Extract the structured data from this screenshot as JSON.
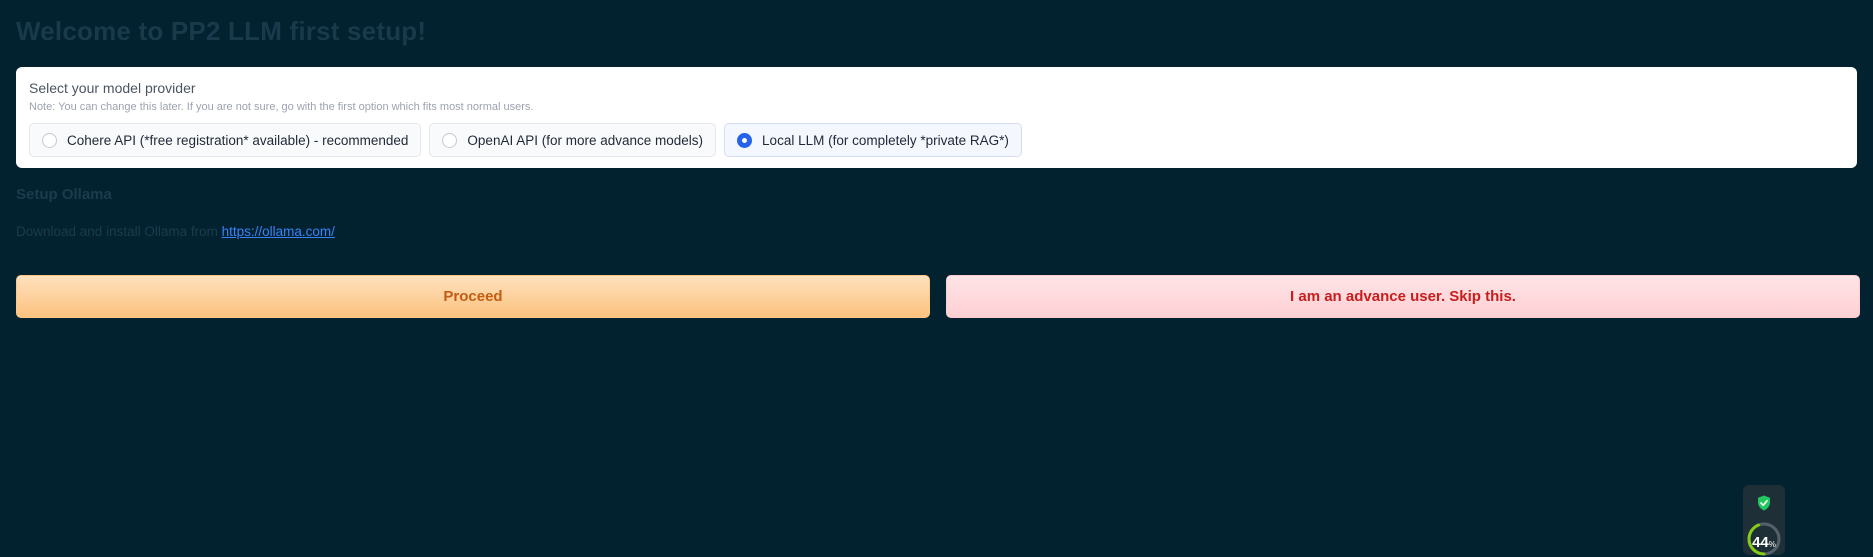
{
  "page": {
    "title": "Welcome to PP2 LLM first setup!"
  },
  "provider": {
    "label": "Select your model provider",
    "note": "Note: You can change this later. If you are not sure, go with the first option which fits most normal users.",
    "options": [
      {
        "label": "Cohere API (*free registration* available) - recommended",
        "selected": false
      },
      {
        "label": "OpenAI API (for more advance models)",
        "selected": false
      },
      {
        "label": "Local LLM (for completely *private RAG*)",
        "selected": true
      }
    ]
  },
  "setup": {
    "title": "Setup Ollama",
    "download_text": "Download and install Ollama from",
    "link_text": "https://ollama.com/"
  },
  "actions": {
    "proceed_label": "Proceed",
    "skip_label": "I am an advance user. Skip this."
  },
  "widget": {
    "value": "44",
    "unit": "%",
    "gauge_fraction": 0.44,
    "shield_color": "#22c55e"
  },
  "colors": {
    "background": "#022230",
    "accent_selected": "#2563eb"
  }
}
